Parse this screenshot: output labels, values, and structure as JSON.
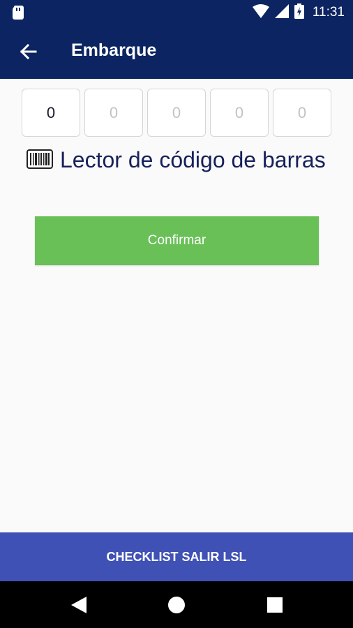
{
  "status_bar": {
    "time": "11:31"
  },
  "app_bar": {
    "title": "Embarque"
  },
  "code_digits": [
    "0",
    "0",
    "0",
    "0",
    "0"
  ],
  "barcode_reader": {
    "label": "Lector de código de barras"
  },
  "confirm_button": {
    "label": "Confirmar"
  },
  "checklist_button": {
    "label": "CHECKLIST SALIR LSL"
  },
  "colors": {
    "primary": "#0c2461",
    "confirm": "#68c057",
    "checklist": "#3f51b5"
  }
}
